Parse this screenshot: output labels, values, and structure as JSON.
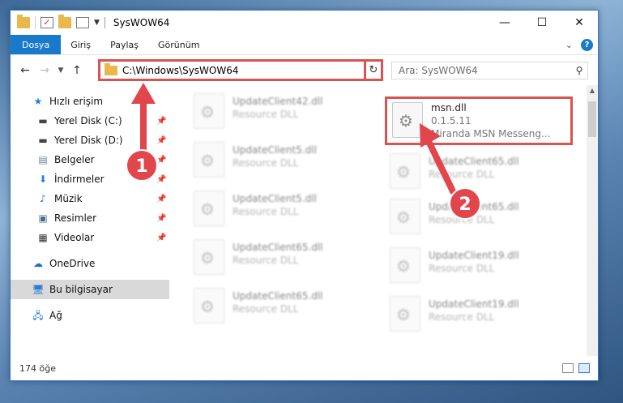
{
  "window": {
    "title": "SysWOW64",
    "controls": {
      "minimize": "—",
      "maximize": "☐",
      "close": "✕"
    }
  },
  "ribbon": {
    "tabs": [
      "Dosya",
      "Giriş",
      "Paylaş",
      "Görünüm"
    ],
    "help": "?"
  },
  "nav": {
    "address": "C:\\Windows\\SysWOW64",
    "search_placeholder": "Ara: SysWOW64"
  },
  "sidebar": {
    "quick_access": "Hızlı erişim",
    "items": [
      "Yerel Disk (C:)",
      "Yerel Disk (D:)",
      "Belgeler",
      "İndirmeler",
      "Müzik",
      "Resimler",
      "Videolar"
    ],
    "onedrive": "OneDrive",
    "this_pc": "Bu bilgisayar",
    "network": "Ağ"
  },
  "files": {
    "left_column": [
      {
        "name": "UpdateClient42.dll",
        "type": "Resource DLL"
      },
      {
        "name": "UpdateClient5.dll",
        "type": "Resource DLL"
      },
      {
        "name": "UpdateClient5.dll",
        "type": "Resource DLL"
      },
      {
        "name": "UpdateClient65.dll",
        "type": "Resource DLL"
      },
      {
        "name": "UpdateClient65.dll",
        "type": "Resource DLL"
      }
    ],
    "right_column": [
      {
        "name": "msn.dll",
        "version": "0.1.5.11",
        "type": "Miranda MSN Messeng..."
      },
      {
        "name": "UpdateClient65.dll",
        "type": "Resource DLL"
      },
      {
        "name": "UpdateClient65.dll",
        "type": "Resource DLL"
      },
      {
        "name": "UpdateClient19.dll",
        "type": "Resource DLL"
      },
      {
        "name": "UpdateClient19.dll",
        "type": "Resource DLL"
      }
    ]
  },
  "status": {
    "count": "174 öğe"
  },
  "annotations": {
    "one": "1",
    "two": "2"
  },
  "colors": {
    "accent": "#1979ca",
    "highlight": "#d9534f"
  }
}
